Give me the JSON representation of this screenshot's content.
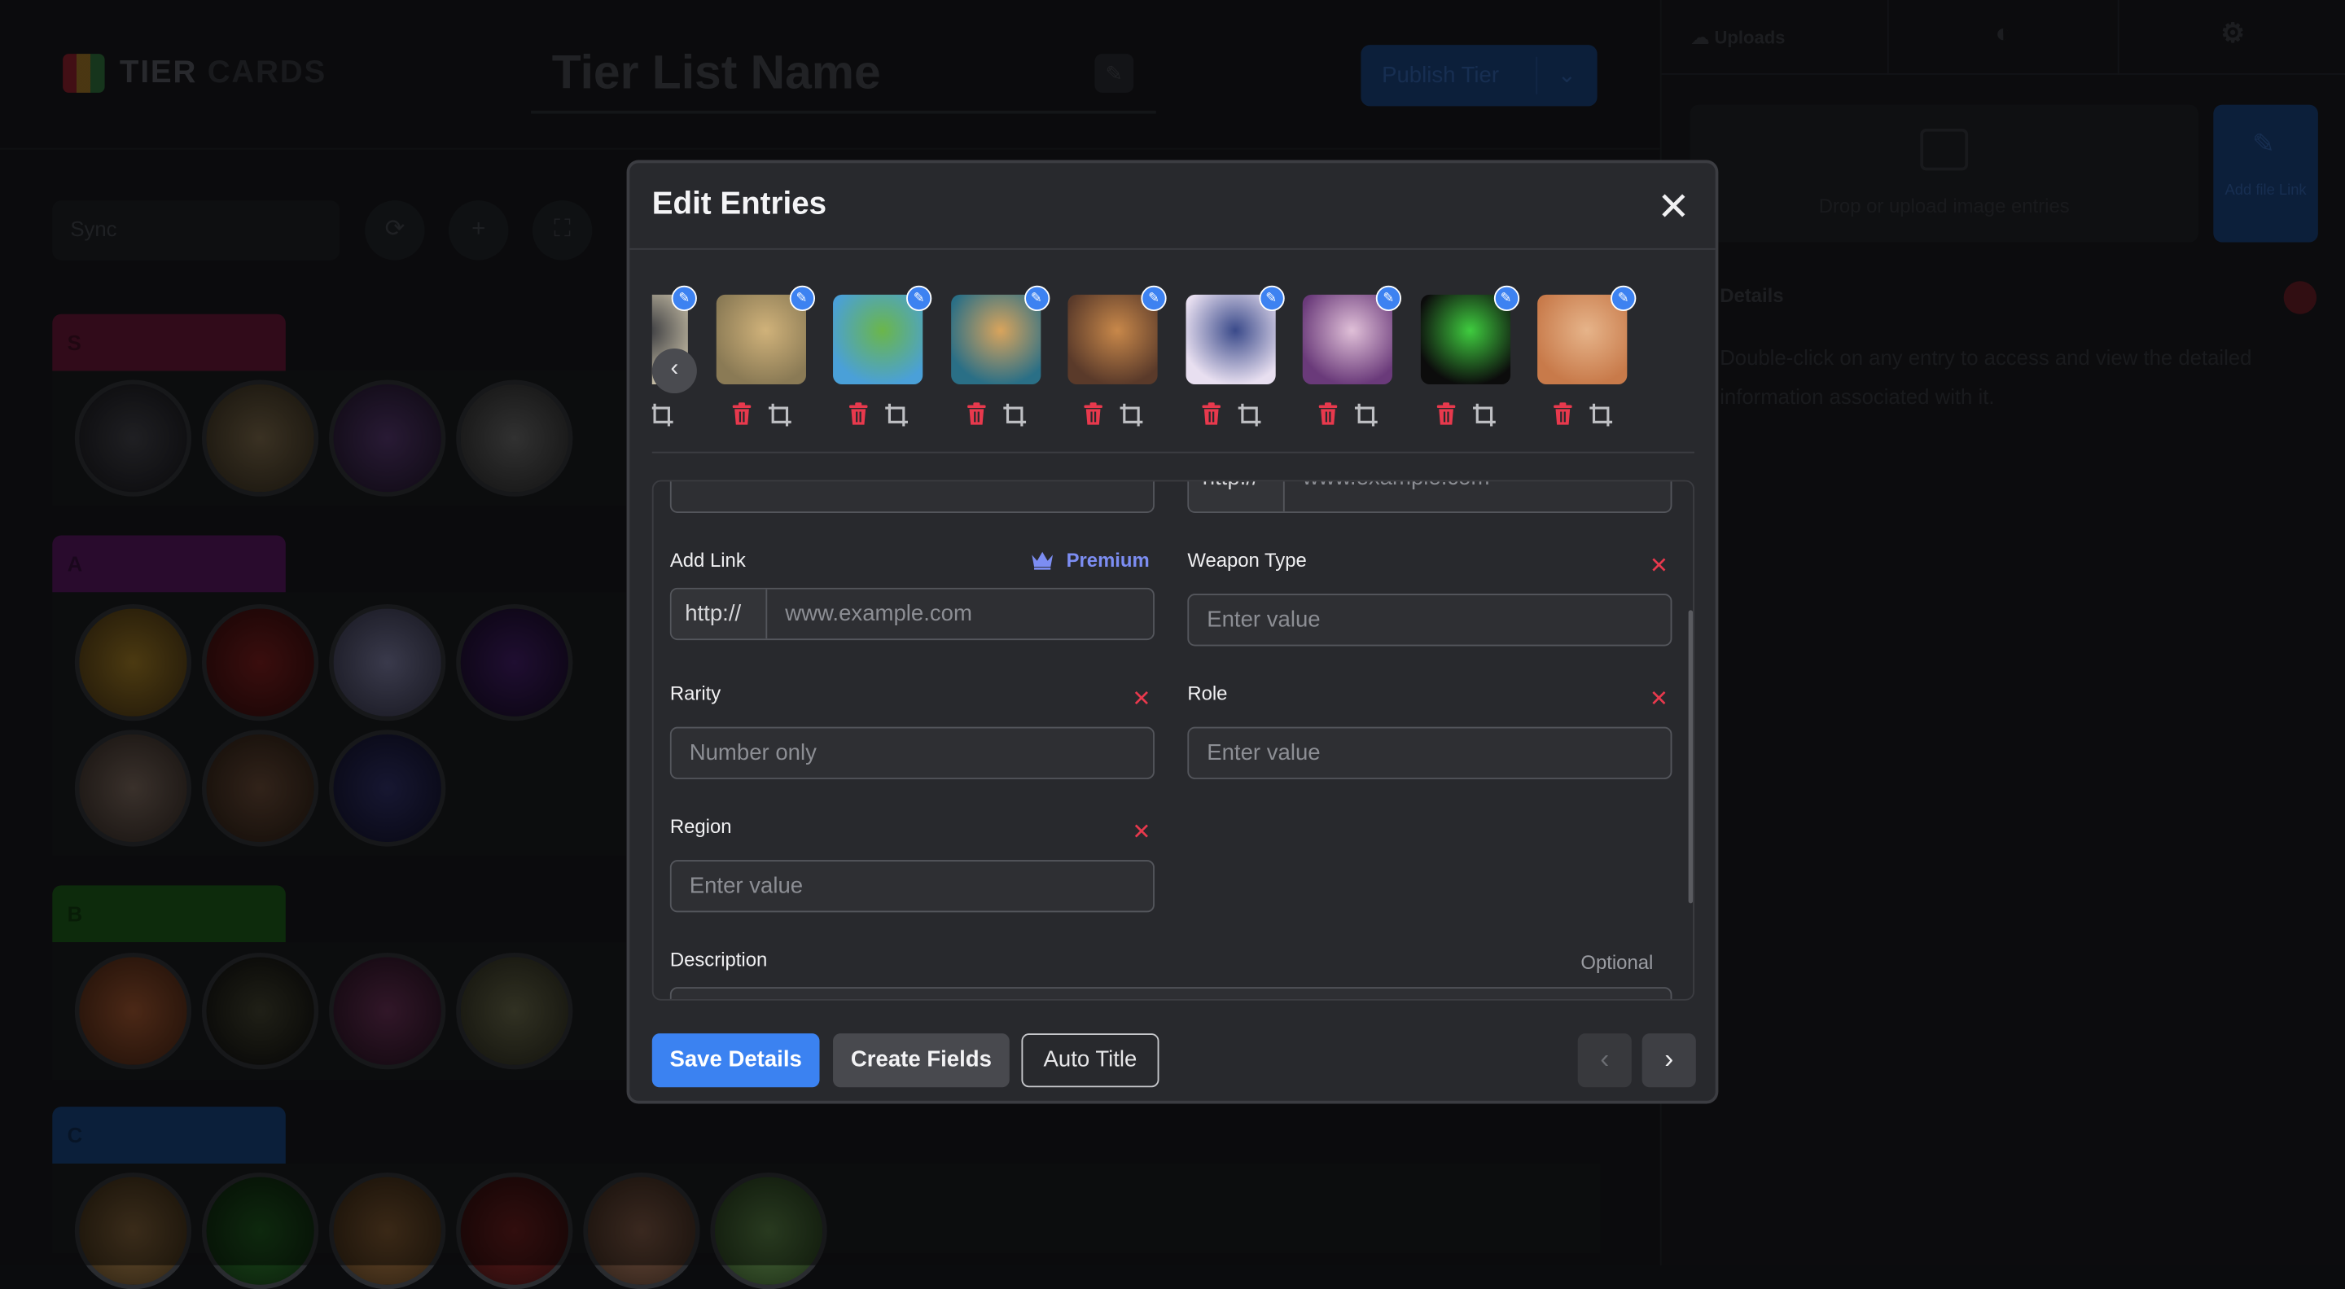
{
  "app": {
    "logo_text_main": "TIER",
    "logo_text_sub": "CARDS",
    "tier_list_title": "Tier List Name",
    "publish_label": "Publish Tier",
    "sort_select": "Sync",
    "tiers": [
      {
        "label": "S",
        "color": "#7a1d3a"
      },
      {
        "label": "A",
        "color": "#6a1a6e"
      },
      {
        "label": "B",
        "color": "#1f6a1e"
      },
      {
        "label": "C",
        "color": "#1a4a8a"
      }
    ],
    "sidebar": {
      "tabs": [
        "Uploads"
      ],
      "drop_text": "Drop or upload image entries",
      "add_file_label": "Add file Link",
      "heading": "Details",
      "description": "Double-click on any entry to access and view the detailed information associated with it."
    }
  },
  "modal": {
    "title": "Edit Entries",
    "close_icon": "close-icon",
    "strip": {
      "prev_icon": "chevron-left-icon",
      "thumbnails": [
        {
          "name": "minion",
          "colors": [
            "#c9c0a8",
            "#3a3b3f"
          ]
        },
        {
          "name": "elephant-safari",
          "colors": [
            "#8a7a55",
            "#d0b27a"
          ]
        },
        {
          "name": "jeep-adventure",
          "colors": [
            "#4aa0d8",
            "#6bb64a"
          ]
        },
        {
          "name": "pilot-girl",
          "colors": [
            "#2a6f86",
            "#d9a45c"
          ]
        },
        {
          "name": "cat-coffee",
          "colors": [
            "#5a3a2a",
            "#c8884a"
          ]
        },
        {
          "name": "sunglasses-girl",
          "colors": [
            "#e8dff0",
            "#3a4a8a"
          ]
        },
        {
          "name": "purple-hair-girl",
          "colors": [
            "#6a3a7a",
            "#e0c0d8"
          ]
        },
        {
          "name": "green-skull",
          "colors": [
            "#0c0c0c",
            "#3fcc3f"
          ]
        },
        {
          "name": "fox-girl",
          "colors": [
            "#c87a4a",
            "#e6b48a"
          ]
        }
      ]
    },
    "form": {
      "top_link_prefix": "http://",
      "top_link_placeholder": "www.example.com",
      "add_link_label": "Add Link",
      "premium_label": "Premium",
      "link_prefix": "http://",
      "link_placeholder": "www.example.com",
      "weapon_type_label": "Weapon Type",
      "weapon_type_placeholder": "Enter value",
      "rarity_label": "Rarity",
      "rarity_placeholder": "Number only",
      "role_label": "Role",
      "role_placeholder": "Enter value",
      "region_label": "Region",
      "region_placeholder": "Enter value",
      "description_label": "Description",
      "description_hint": "Optional"
    },
    "footer": {
      "save_label": "Save Details",
      "create_label": "Create Fields",
      "auto_title_label": "Auto Title",
      "prev_icon": "chevron-left-icon",
      "next_icon": "chevron-right-icon"
    },
    "colors": {
      "accent": "#3b82f1",
      "danger": "#e8394d",
      "premium": "#7c8df2"
    }
  }
}
